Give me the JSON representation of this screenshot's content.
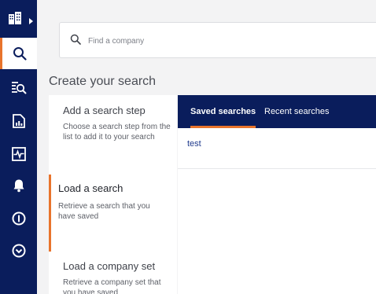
{
  "search": {
    "placeholder": "Find a company"
  },
  "page_title": "Create your search",
  "steps": [
    {
      "title": "Add a search step",
      "description": "Choose a search step from the list to add it to your search"
    },
    {
      "title": "Load a search",
      "description": "Retrieve a search that you have saved"
    },
    {
      "title": "Load a company set",
      "description": "Retrieve a company set that you have saved"
    }
  ],
  "tabs": [
    {
      "label": "Saved searches"
    },
    {
      "label": "Recent searches"
    }
  ],
  "saved_searches": [
    {
      "name": "test"
    }
  ],
  "rail": {
    "icons": [
      "buildings-icon",
      "search-icon",
      "search-list-icon",
      "report-icon",
      "pulse-icon",
      "bell-icon",
      "alert-circle-icon",
      "chevron-circle-icon"
    ]
  },
  "colors": {
    "nav": "#0a1d5c",
    "accent": "#e8742c",
    "link": "#1f3a8c"
  }
}
